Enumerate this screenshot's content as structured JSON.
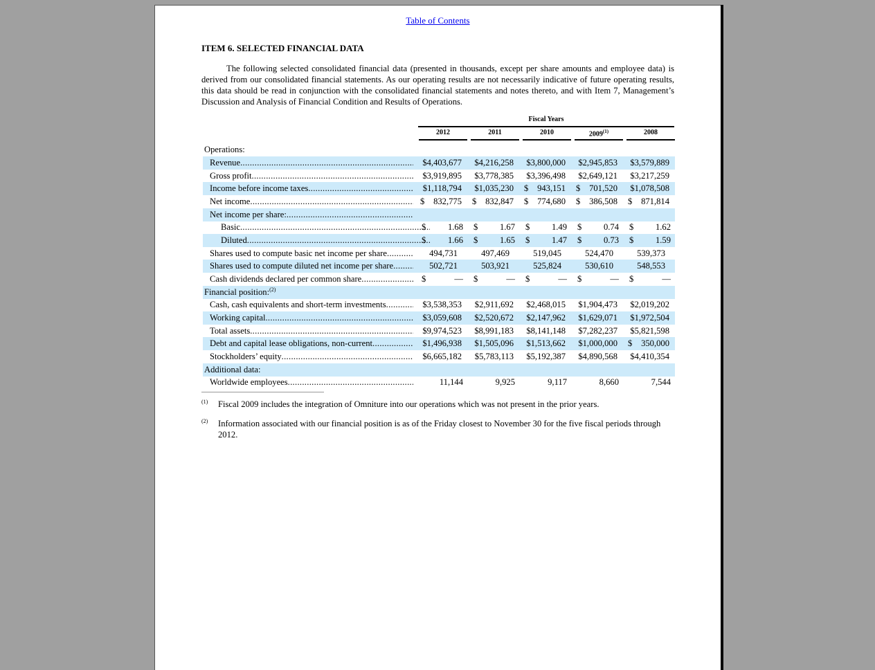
{
  "toc_link": "Table of Contents",
  "title": "ITEM 6.  SELECTED FINANCIAL DATA",
  "intro": "The following selected consolidated financial data (presented in thousands, except per share amounts and employee data) is derived from our consolidated financial statements. As our operating results are not necessarily indicative of future operating results, this data should be read in conjunction with the consolidated financial statements and notes thereto, and with Item 7, Management’s Discussion and Analysis of Financial Condition and Results of Operations.",
  "table": {
    "group_header": "Fiscal Years",
    "years": [
      {
        "label": "2012",
        "note": ""
      },
      {
        "label": "2011",
        "note": ""
      },
      {
        "label": "2010",
        "note": ""
      },
      {
        "label": "2009",
        "note": "(1)"
      },
      {
        "label": "2008",
        "note": ""
      }
    ],
    "rows": [
      {
        "label": "Operations:",
        "indent": 0,
        "section": true,
        "hl": false,
        "cells": []
      },
      {
        "label": "Revenue",
        "indent": 1,
        "hl": true,
        "cells": [
          [
            "$",
            "4,403,677"
          ],
          [
            "$",
            "4,216,258"
          ],
          [
            "$",
            "3,800,000"
          ],
          [
            "$",
            "2,945,853"
          ],
          [
            "$",
            "3,579,889"
          ]
        ],
        "tight": true
      },
      {
        "label": "Gross profit",
        "indent": 1,
        "hl": false,
        "cells": [
          [
            "$",
            "3,919,895"
          ],
          [
            "$",
            "3,778,385"
          ],
          [
            "$",
            "3,396,498"
          ],
          [
            "$",
            "2,649,121"
          ],
          [
            "$",
            "3,217,259"
          ]
        ],
        "tight": true
      },
      {
        "label": "Income before income taxes",
        "indent": 1,
        "hl": true,
        "cells": [
          [
            "$",
            "1,118,794"
          ],
          [
            "$",
            "1,035,230"
          ],
          [
            "$",
            " 943,151"
          ],
          [
            "$",
            " 701,520"
          ],
          [
            "$",
            "1,078,508"
          ]
        ],
        "tight": true
      },
      {
        "label": "Net income",
        "indent": 1,
        "hl": false,
        "cells": [
          [
            "$",
            " 832,775"
          ],
          [
            "$",
            " 832,847"
          ],
          [
            "$",
            " 774,680"
          ],
          [
            "$",
            " 386,508"
          ],
          [
            "$",
            " 871,814"
          ]
        ],
        "tight": true
      },
      {
        "label": "Net income per share:",
        "indent": 1,
        "hl": true,
        "cells": []
      },
      {
        "label": "Basic",
        "indent": 2,
        "hl": false,
        "cells": [
          [
            "$",
            "1.68"
          ],
          [
            "$",
            "1.67"
          ],
          [
            "$",
            "1.49"
          ],
          [
            "$",
            "0.74"
          ],
          [
            "$",
            "1.62"
          ]
        ]
      },
      {
        "label": "Diluted",
        "indent": 2,
        "hl": true,
        "cells": [
          [
            "$",
            "1.66"
          ],
          [
            "$",
            "1.65"
          ],
          [
            "$",
            "1.47"
          ],
          [
            "$",
            "0.73"
          ],
          [
            "$",
            "1.59"
          ]
        ]
      },
      {
        "label": "Shares used to compute basic net income per share",
        "indent": 1,
        "hl": false,
        "cells": [
          [
            "",
            "494,731"
          ],
          [
            "",
            "497,469"
          ],
          [
            "",
            "519,045"
          ],
          [
            "",
            "524,470"
          ],
          [
            "",
            "539,373"
          ]
        ],
        "center": true
      },
      {
        "label": "Shares used to compute diluted net income per share",
        "indent": 1,
        "hl": true,
        "cells": [
          [
            "",
            "502,721"
          ],
          [
            "",
            "503,921"
          ],
          [
            "",
            "525,824"
          ],
          [
            "",
            "530,610"
          ],
          [
            "",
            "548,553"
          ]
        ],
        "center": true
      },
      {
        "label": "Cash dividends declared per common share",
        "indent": 1,
        "hl": false,
        "cells": [
          [
            "$",
            "—"
          ],
          [
            "$",
            "—"
          ],
          [
            "$",
            "—"
          ],
          [
            "$",
            "—"
          ],
          [
            "$",
            "—"
          ]
        ]
      },
      {
        "label": "Financial position:",
        "note": "(2)",
        "indent": 0,
        "section": true,
        "hl": true,
        "cells": []
      },
      {
        "label": "Cash, cash equivalents and short-term investments",
        "indent": 1,
        "hl": false,
        "cells": [
          [
            "$",
            "3,538,353"
          ],
          [
            "$",
            "2,911,692"
          ],
          [
            "$",
            "2,468,015"
          ],
          [
            "$",
            "1,904,473"
          ],
          [
            "$",
            "2,019,202"
          ]
        ],
        "tight": true
      },
      {
        "label": "Working capital",
        "indent": 1,
        "hl": true,
        "cells": [
          [
            "$",
            "3,059,608"
          ],
          [
            "$",
            "2,520,672"
          ],
          [
            "$",
            "2,147,962"
          ],
          [
            "$",
            "1,629,071"
          ],
          [
            "$",
            "1,972,504"
          ]
        ],
        "tight": true
      },
      {
        "label": "Total assets",
        "indent": 1,
        "hl": false,
        "cells": [
          [
            "$",
            "9,974,523"
          ],
          [
            "$",
            "8,991,183"
          ],
          [
            "$",
            "8,141,148"
          ],
          [
            "$",
            "7,282,237"
          ],
          [
            "$",
            "5,821,598"
          ]
        ],
        "tight": true
      },
      {
        "label": "Debt and capital lease obligations, non-current",
        "indent": 1,
        "hl": true,
        "cells": [
          [
            "$",
            "1,496,938"
          ],
          [
            "$",
            "1,505,096"
          ],
          [
            "$",
            "1,513,662"
          ],
          [
            "$",
            "1,000,000"
          ],
          [
            "$",
            " 350,000"
          ]
        ],
        "tight": true
      },
      {
        "label": "Stockholders’ equity",
        "indent": 1,
        "hl": false,
        "cells": [
          [
            "$",
            "6,665,182"
          ],
          [
            "$",
            "5,783,113"
          ],
          [
            "$",
            "5,192,387"
          ],
          [
            "$",
            "4,890,568"
          ],
          [
            "$",
            "4,410,354"
          ]
        ],
        "tight": true
      },
      {
        "label": "Additional data:",
        "indent": 0,
        "section": true,
        "hl": true,
        "cells": []
      },
      {
        "label": "Worldwide employees",
        "indent": 1,
        "hl": false,
        "cells": [
          [
            "",
            "11,144"
          ],
          [
            "",
            "9,925"
          ],
          [
            "",
            "9,117"
          ],
          [
            "",
            "8,660"
          ],
          [
            "",
            "7,544"
          ]
        ]
      }
    ]
  },
  "footnotes": [
    {
      "mark": "(1)",
      "text": "Fiscal 2009 includes the integration of Omniture into our operations which was not present in the prior years."
    },
    {
      "mark": "(2)",
      "text": "Information associated with our financial position is as of the Friday closest to November 30 for the five fiscal periods through 2012."
    }
  ],
  "colors": {
    "row_highlight": "#cdeafa",
    "link": "#0000ee",
    "viewer_bg": "#a0a0a0"
  }
}
